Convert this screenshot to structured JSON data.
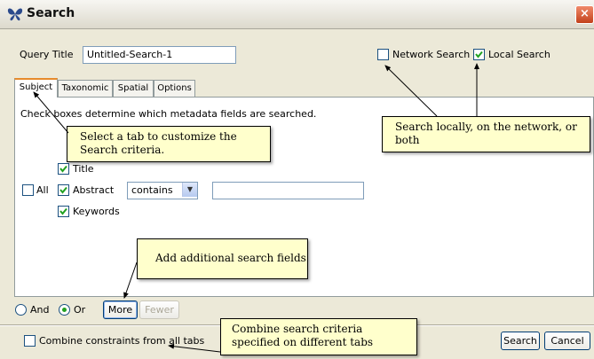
{
  "window": {
    "title": "Search",
    "close_glyph": "×"
  },
  "query": {
    "label": "Query Title",
    "value": "Untitled-Search-1"
  },
  "search_mode": {
    "network": {
      "label": "Network Search",
      "checked": false
    },
    "local": {
      "label": "Local Search",
      "checked": true
    }
  },
  "tabs": [
    {
      "label": "Subject",
      "active": true
    },
    {
      "label": "Taxonomic",
      "active": false
    },
    {
      "label": "Spatial",
      "active": false
    },
    {
      "label": "Options",
      "active": false
    }
  ],
  "subject": {
    "description": "Check boxes determine which metadata fields are searched.",
    "all_label": "All",
    "fields": [
      {
        "label": "Title",
        "checked": true
      },
      {
        "label": "Abstract",
        "checked": true
      },
      {
        "label": "Keywords",
        "checked": true
      }
    ],
    "operator": "contains",
    "search_text": ""
  },
  "logic": {
    "and_label": "And",
    "or_label": "Or",
    "selected": "Or"
  },
  "buttons": {
    "more": "More",
    "fewer": "Fewer",
    "search": "Search",
    "cancel": "Cancel"
  },
  "combine": {
    "label": "Combine constraints from all tabs",
    "checked": false
  },
  "callouts": {
    "tab_hint": "Select a tab to customize the Search criteria.",
    "scope_hint": "Search locally, on the network, or both",
    "more_hint": "Add additional search fields",
    "combine_hint": "Combine search criteria specified on different tabs"
  },
  "colors": {
    "callout_bg": "#ffffcc",
    "window_bg": "#ece9d8",
    "check_green": "#21a121",
    "tab_accent": "#e68b2c"
  }
}
